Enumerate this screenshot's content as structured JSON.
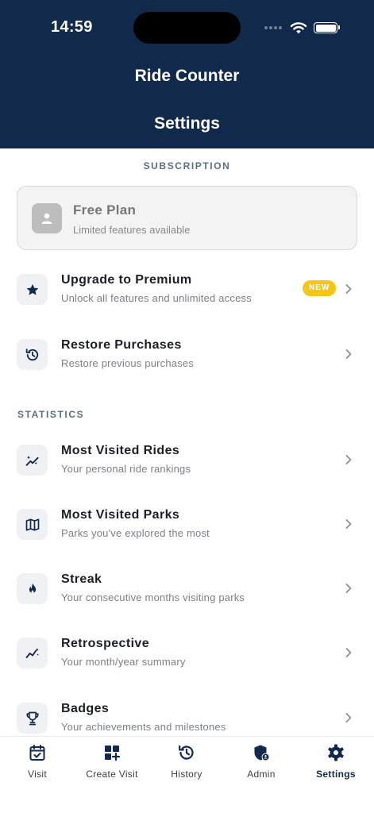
{
  "status_bar": {
    "time": "14:59"
  },
  "header": {
    "app_title": "Ride Counter",
    "page_title": "Settings"
  },
  "subscription": {
    "section_label": "SUBSCRIPTION",
    "plan": {
      "title": "Free Plan",
      "subtitle": "Limited features available",
      "icon": "person-icon"
    }
  },
  "items": [
    {
      "title": "Upgrade to Premium",
      "desc": "Unlock all features and unlimited access",
      "icon": "star-icon",
      "badge": "NEW"
    },
    {
      "title": "Restore Purchases",
      "desc": "Restore previous purchases",
      "icon": "restore-icon"
    }
  ],
  "statistics": {
    "section_label": "STATISTICS",
    "items": [
      {
        "title": "Most Visited Rides",
        "desc": "Your personal ride rankings",
        "icon": "ranking-chart-icon"
      },
      {
        "title": "Most Visited Parks",
        "desc": "Parks you've explored the most",
        "icon": "map-icon"
      },
      {
        "title": "Streak",
        "desc": "Your consecutive months visiting parks",
        "icon": "flame-icon"
      },
      {
        "title": "Retrospective",
        "desc": "Your month/year summary",
        "icon": "trend-icon"
      },
      {
        "title": "Badges",
        "desc": "Your achievements and milestones",
        "icon": "trophy-icon"
      }
    ]
  },
  "tabs": [
    {
      "label": "Visit",
      "icon": "calendar-check-icon",
      "active": false
    },
    {
      "label": "Create Visit",
      "icon": "grid-add-icon",
      "active": false
    },
    {
      "label": "History",
      "icon": "history-icon",
      "active": false
    },
    {
      "label": "Admin",
      "icon": "admin-shield-icon",
      "active": false
    },
    {
      "label": "Settings",
      "icon": "gear-icon",
      "active": true
    }
  ],
  "colors": {
    "header_bg": "#11294a",
    "badge": "#f5c518",
    "section_label": "#5a6f85"
  }
}
